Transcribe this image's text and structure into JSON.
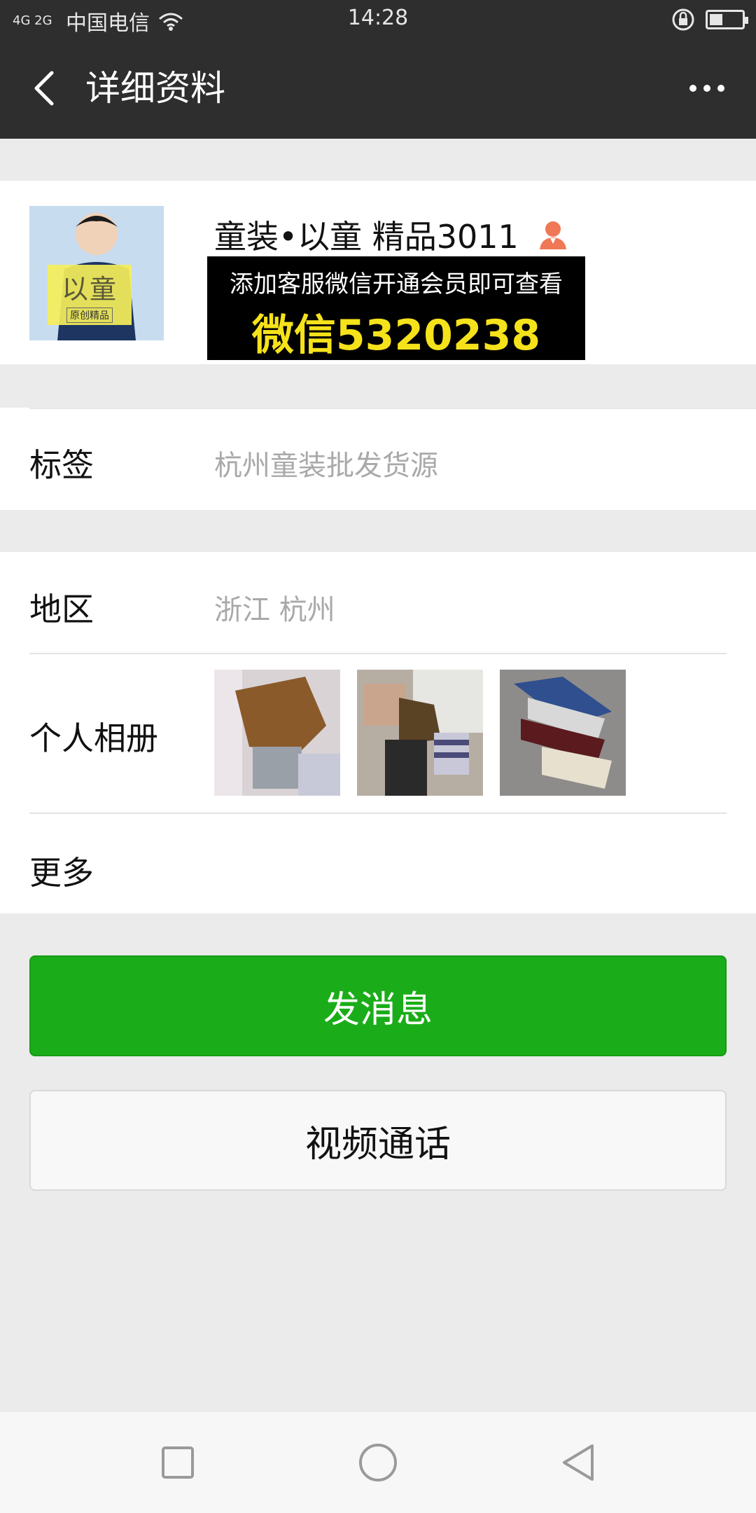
{
  "status_bar": {
    "network": "4G 2G",
    "carrier": "中国电信",
    "time": "14:28",
    "battery_level_percent": 35
  },
  "nav": {
    "title": "详细资料"
  },
  "profile": {
    "name": "童装•以童 精品3011",
    "avatar_logo_text": "以童",
    "avatar_logo_subtext": "原创精品",
    "promo_line1": "添加客服微信开通会员即可查看",
    "promo_line2": "微信5320238"
  },
  "tags": {
    "label": "标签",
    "value": "杭州童装批发货源"
  },
  "region": {
    "label": "地区",
    "value": "浙江  杭州"
  },
  "album": {
    "label": "个人相册",
    "thumbnails": [
      "album-photo-1",
      "album-photo-2",
      "album-photo-3"
    ]
  },
  "more": {
    "label": "更多"
  },
  "buttons": {
    "send_message": "发消息",
    "video_call": "视频通话"
  },
  "colors": {
    "nav_background": "#2e2e2e",
    "primary_button": "#1aad19",
    "promo_yellow": "#f6e21b",
    "person_icon": "#f07856"
  },
  "icons": {
    "back": "chevron-left-icon",
    "more": "more-dots-icon",
    "person": "contact-person-icon",
    "wifi": "wifi-icon",
    "lock_rotate": "rotation-lock-icon",
    "battery": "battery-icon",
    "sys_recent": "square-icon",
    "sys_home": "circle-icon",
    "sys_back": "triangle-back-icon"
  }
}
